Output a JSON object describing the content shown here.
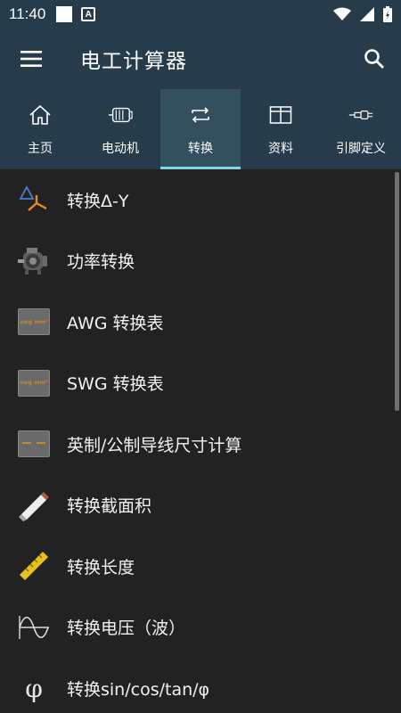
{
  "status_bar": {
    "time": "11:40",
    "notif_letter": "A"
  },
  "app_bar": {
    "title": "电工计算器",
    "menu_icon": "hamburger-menu-icon",
    "search_icon": "search-icon"
  },
  "tabs": [
    {
      "label": "主页",
      "icon": "home-icon",
      "active": false
    },
    {
      "label": "电动机",
      "icon": "motor-icon",
      "active": false
    },
    {
      "label": "转换",
      "icon": "convert-icon",
      "active": true
    },
    {
      "label": "资料",
      "icon": "table-icon",
      "active": false
    },
    {
      "label": "引脚定义",
      "icon": "connector-icon",
      "active": false
    }
  ],
  "list": [
    {
      "label": "转换Δ-Y",
      "icon": "delta-y-icon"
    },
    {
      "label": "功率转换",
      "icon": "motor-power-icon"
    },
    {
      "label": "AWG 转换表",
      "icon": "awg-table-icon",
      "badge_a": "awg",
      "badge_b": "mm²"
    },
    {
      "label": "SWG 转换表",
      "icon": "swg-table-icon",
      "badge_a": "swg",
      "badge_b": "mm²"
    },
    {
      "label": "英制/公制导线尺寸计算",
      "icon": "wire-size-icon"
    },
    {
      "label": "转换截面积",
      "icon": "cable-section-icon"
    },
    {
      "label": "转换长度",
      "icon": "ruler-icon"
    },
    {
      "label": "转换电压（波）",
      "icon": "voltage-wave-icon"
    },
    {
      "label": "转换sin/cos/tan/φ",
      "icon": "phi-icon",
      "glyph": "φ"
    }
  ],
  "colors": {
    "app_bar": "#263c4a",
    "active_tab": "#33505f",
    "indicator": "#7fd9e8",
    "list_bg": "#222222"
  }
}
